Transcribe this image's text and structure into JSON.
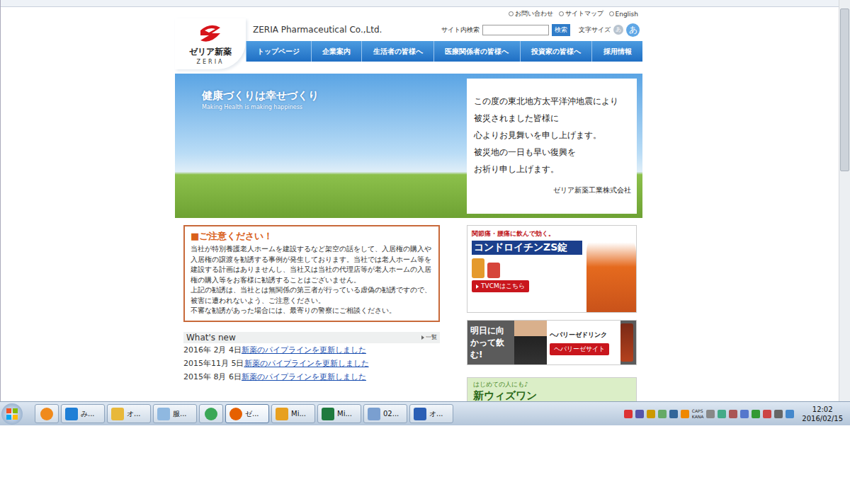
{
  "browser": {
    "top_links": [
      "お問い合わせ",
      "サイトマップ",
      "English"
    ],
    "scrollbar": {
      "level": 0.42
    }
  },
  "header": {
    "logo": {
      "name": "ゼリア新薬",
      "roman": "ZERIA"
    },
    "company": "ZERIA Pharmaceutical Co.,Ltd.",
    "search": {
      "label": "サイト内検索",
      "value": "",
      "button": "検索"
    },
    "font_size": {
      "label": "文字サイズ",
      "options": [
        {
          "label": "あ",
          "selected": false
        },
        {
          "label": "あ",
          "selected": true
        }
      ]
    }
  },
  "nav": [
    {
      "label": "トップページ"
    },
    {
      "label": "企業案内"
    },
    {
      "label": "生活者の皆様へ"
    },
    {
      "label": "医療関係者の皆様へ"
    },
    {
      "label": "投資家の皆様へ"
    },
    {
      "label": "採用情報"
    }
  ],
  "hero": {
    "tagline": "健康づくりは幸せづくり",
    "subtagline": "Making Health is making happiness",
    "message": [
      "この度の東北地方太平洋沖地震により",
      "被災されました皆様に",
      "心よりお見舞いを申し上げます。",
      "被災地の一日も早い復興を",
      "お祈り申し上げます。"
    ],
    "signature": "ゼリア新薬工業株式会社"
  },
  "notice": {
    "title": "■ご注意ください！",
    "paragraphs": [
      "当社が特別養護老人ホームを建設するなど架空の話をして、入居権の購入や入居権の譲渡を勧誘する事例が発生しております。当社では老人ホーム等を建設する計画はありませんし、当社又は当社の代理店等が老人ホームの入居権の購入等をお客様に勧誘することはございません。",
      "上記の勧誘は、当社とは無関係の第三者が行っている虚偽の勧誘ですので、被害に遭われないよう、ご注意ください。",
      "不審な勧誘があった場合には、最寄りの警察にご相談ください。"
    ]
  },
  "news": {
    "title": "What's new",
    "more": "一覧",
    "items": [
      {
        "date": "2016年 2月 4日",
        "text": "新薬のパイプラインを更新しました"
      },
      {
        "date": "2015年11月 5日",
        "text": "新薬のパイプラインを更新しました"
      },
      {
        "date": "2015年 8月 6日",
        "text": "新薬のパイプラインを更新しました"
      }
    ]
  },
  "banners": [
    {
      "kind": "chondroitin",
      "catch": "関節痛・腰痛に飲んで効く。",
      "product": "コンドロイチンZS錠",
      "button": "TVCMはこちら"
    },
    {
      "kind": "hepalyse",
      "catch": "明日に向かって飲む!",
      "product": "ヘパリーゼドリンク",
      "button": "ヘパリーゼサイト"
    },
    {
      "kind": "withone",
      "catch": "はじめての人にも♪",
      "product": "新ウィズワン",
      "button": ""
    }
  ],
  "taskbar": {
    "apps": [
      {
        "kind": "media",
        "label": "",
        "selected": false
      },
      {
        "kind": "ie",
        "label": "み...",
        "selected": false
      },
      {
        "kind": "folder",
        "label": "オ...",
        "selected": false
      },
      {
        "kind": "notepad",
        "label": "服...",
        "selected": false
      },
      {
        "kind": "chrome",
        "label": "",
        "selected": false
      },
      {
        "kind": "firefox",
        "label": "ゼ...",
        "selected": true
      },
      {
        "kind": "outlook",
        "label": "Mi...",
        "selected": false
      },
      {
        "kind": "excel",
        "label": "Mi...",
        "selected": false
      },
      {
        "kind": "paint",
        "label": "02...",
        "selected": false
      },
      {
        "kind": "word",
        "label": "オ...",
        "selected": false
      }
    ],
    "ime": [
      "CAPS",
      "KANA"
    ],
    "time": "12:02",
    "date": "2016/02/15"
  }
}
